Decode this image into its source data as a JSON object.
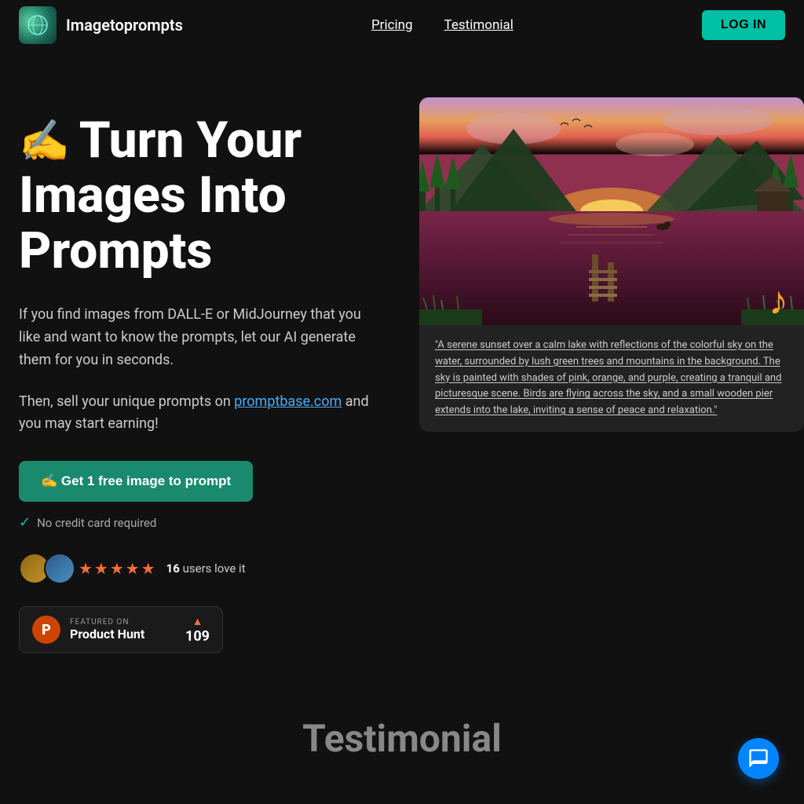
{
  "header": {
    "site_name": "Imagetoprompts",
    "nav": {
      "pricing_label": "Pricing",
      "testimonial_label": "Testimonial"
    },
    "login_label": "LOG IN"
  },
  "hero": {
    "title_emoji": "✍️",
    "title_line1": "Turn Your",
    "title_line2": "Images Into",
    "title_line3": "Prompts",
    "description1": "If you find images from DALL-E or MidJourney that you like and want to know the prompts, let our AI generate them for you in seconds.",
    "description2_pre": "Then, sell your unique prompts on ",
    "promptbase_link_text": "promptbase.com",
    "description2_post": " and you may start earning!",
    "cta_label": "✍️ Get 1 free image to prompt",
    "no_credit_text": "No credit card required",
    "users_count": "16",
    "users_label": "users love it",
    "product_hunt": {
      "featured_on": "FEATURED ON",
      "name": "Product Hunt",
      "count": "109"
    }
  },
  "image_caption": "\"A serene sunset over a calm lake with reflections of the colorful sky on the water, surrounded by lush green trees and mountains in the background. The sky is painted with shades of pink, orange, and purple, creating a tranquil and picturesque scene. Birds are flying across the sky, and a small wooden pier extends into the lake, inviting a sense of peace and relaxation.\"",
  "testimonial": {
    "title": "Testimonial"
  },
  "colors": {
    "bg": "#111111",
    "accent": "#00bfa5",
    "cta_bg": "#1a8a6e",
    "login_bg": "#00bfa5"
  }
}
